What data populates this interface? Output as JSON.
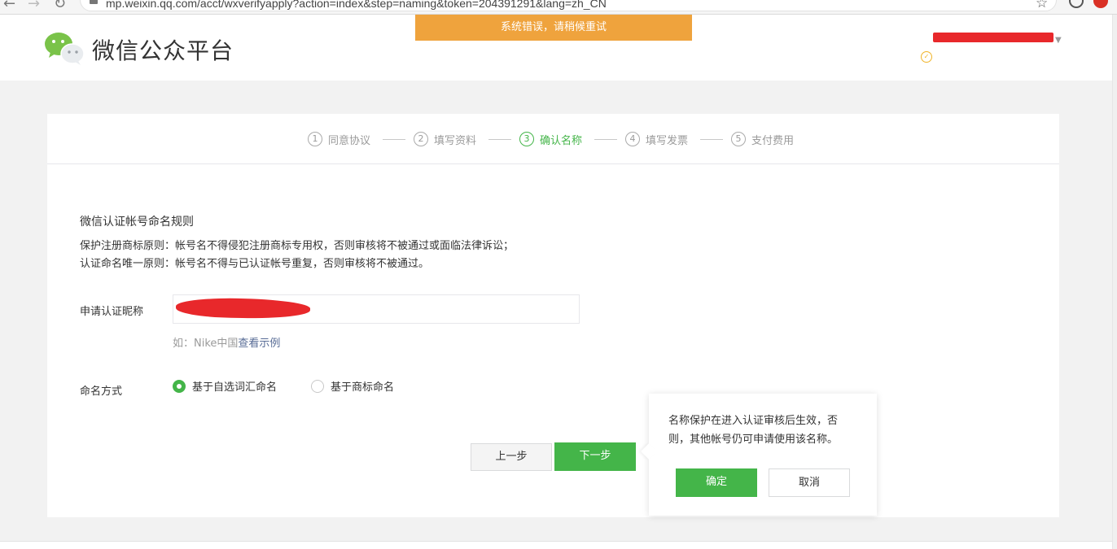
{
  "browser": {
    "url": "mp.weixin.qq.com/acct/wxverifyapply?action=index&step=naming&token=204391291&lang=zh_CN"
  },
  "header": {
    "logo_text": "微信公众平台",
    "error_toast": "系统错误，请稍候重试"
  },
  "steps": [
    {
      "num": "1",
      "label": "同意协议",
      "active": false
    },
    {
      "num": "2",
      "label": "填写资料",
      "active": false
    },
    {
      "num": "3",
      "label": "确认名称",
      "active": true
    },
    {
      "num": "4",
      "label": "填写发票",
      "active": false
    },
    {
      "num": "5",
      "label": "支付费用",
      "active": false
    }
  ],
  "rules": {
    "title": "微信认证帐号命名规则",
    "line1": "保护注册商标原则：帐号名不得侵犯注册商标专用权，否则审核将不被通过或面临法律诉讼；",
    "line2": "认证命名唯一原则：帐号名不得与已认证帐号重复，否则审核将不被通过。"
  },
  "form": {
    "nickname_label": "申请认证昵称",
    "hint_prefix": "如：Nike中国",
    "hint_link": "查看示例",
    "naming_label": "命名方式",
    "option1": "基于自选词汇命名",
    "option2": "基于商标命名"
  },
  "buttons": {
    "prev": "上一步",
    "next": "下一步"
  },
  "popover": {
    "text": "名称保护在进入认证审核后生效，否则，其他帐号仍可申请使用该名称。",
    "confirm": "确定",
    "cancel": "取消"
  },
  "colors": {
    "accent": "#44b549",
    "toast": "#efa33d",
    "link": "#576b95"
  }
}
